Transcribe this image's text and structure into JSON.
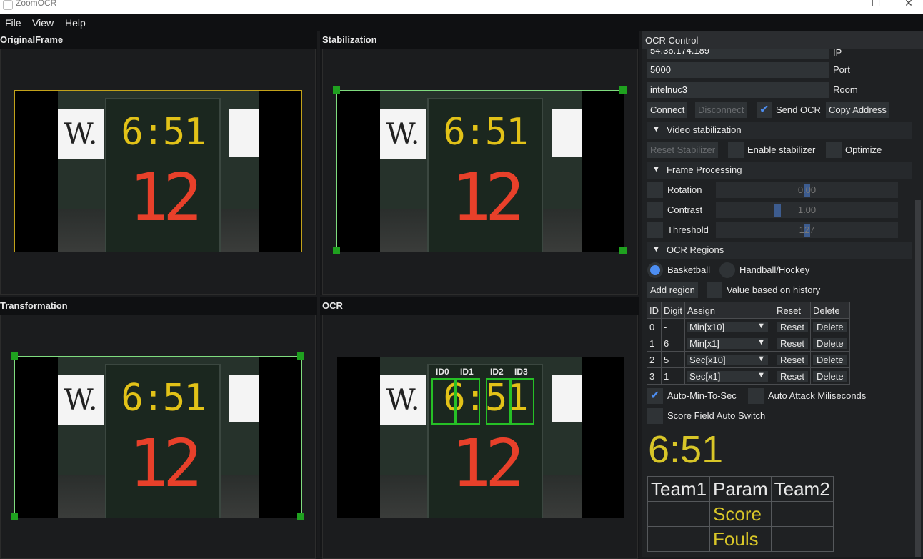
{
  "app": {
    "title": "ZoomOCR"
  },
  "window_controls": {
    "minimize": "—",
    "maximize": "☐",
    "close": "✕"
  },
  "menu": [
    "File",
    "View",
    "Help"
  ],
  "panels": {
    "original": "OriginalFrame",
    "stabilization": "Stabilization",
    "transformation": "Transformation",
    "ocr": "OCR"
  },
  "scoreboard": {
    "clock": "6:51",
    "score": "12",
    "sign_letter": "W."
  },
  "ocr_labels": [
    "ID0",
    "ID1",
    "ID2",
    "ID3"
  ],
  "control": {
    "title": "OCR Control",
    "ip_value": "54.36.174.189",
    "ip_label": "IP",
    "port_value": "5000",
    "port_label": "Port",
    "room_value": "intelnuc3",
    "room_label": "Room",
    "connect": "Connect",
    "disconnect": "Disconnect",
    "send_ocr": "Send OCR",
    "copy_address": "Copy Address",
    "video_stab": "Video stabilization",
    "reset_stab": "Reset Stabilizer",
    "enable_stab": "Enable stabilizer",
    "optimize": "Optimize",
    "frame_proc": "Frame Processing",
    "rotation": "Rotation",
    "rotation_val": "0.00",
    "contrast": "Contrast",
    "contrast_val": "1.00",
    "threshold": "Threshold",
    "threshold_val": "127",
    "ocr_regions": "OCR Regions",
    "basketball": "Basketball",
    "handball": "Handball/Hockey",
    "add_region": "Add region",
    "history": "Value based on history",
    "auto_min": "Auto-Min-To-Sec",
    "auto_attack": "Auto Attack Miliseconds",
    "score_switch": "Score Field Auto Switch",
    "current_time": "6:51"
  },
  "regions_table": {
    "headers": [
      "ID",
      "Digit",
      "Assign",
      "Reset",
      "Delete"
    ],
    "rows": [
      {
        "id": "0",
        "digit": "-",
        "assign": "Min[x10]",
        "reset": "Reset",
        "delete": "Delete"
      },
      {
        "id": "1",
        "digit": "6",
        "assign": "Min[x1]",
        "reset": "Reset",
        "delete": "Delete"
      },
      {
        "id": "2",
        "digit": "5",
        "assign": "Sec[x10]",
        "reset": "Reset",
        "delete": "Delete"
      },
      {
        "id": "3",
        "digit": "1",
        "assign": "Sec[x1]",
        "reset": "Reset",
        "delete": "Delete"
      }
    ]
  },
  "teams_table": {
    "headers": [
      "Team1",
      "Param",
      "Team2"
    ],
    "params": [
      "Score",
      "Fouls"
    ]
  },
  "colors": {
    "accent": "#4d8ef2",
    "highlight": "#d8c628",
    "ocr_box": "#26c026"
  }
}
